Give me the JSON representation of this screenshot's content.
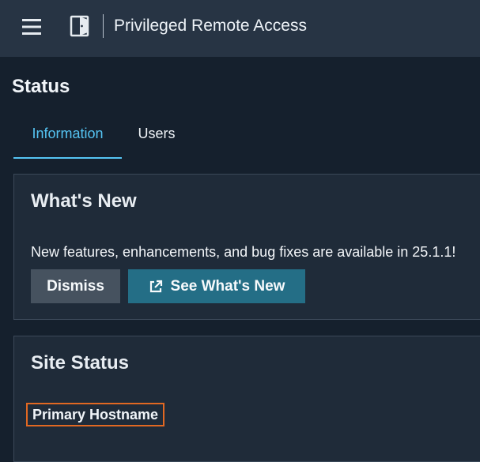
{
  "topbar": {
    "title": "Privileged Remote Access",
    "icons": {
      "menu": "hamburger-menu-icon",
      "app": "door-icon"
    }
  },
  "page": {
    "title": "Status"
  },
  "tabs": [
    {
      "label": "Information",
      "active": true
    },
    {
      "label": "Users",
      "active": false
    }
  ],
  "whats_new": {
    "title": "What's New",
    "message": "New features, enhancements, and bug fixes are available in 25.1.1!",
    "dismiss_label": "Dismiss",
    "see_new_label": "See What's New",
    "see_new_icon": "external-link-icon"
  },
  "site_status": {
    "title": "Site Status",
    "primary_hostname_label": "Primary Hostname"
  },
  "colors": {
    "topbar_bg": "#273444",
    "page_bg": "#15202d",
    "card_bg": "#1f2b39",
    "accent": "#55c4f3",
    "primary_button": "#246e86",
    "secondary_button": "#46525f",
    "highlight_border": "#e16822"
  }
}
